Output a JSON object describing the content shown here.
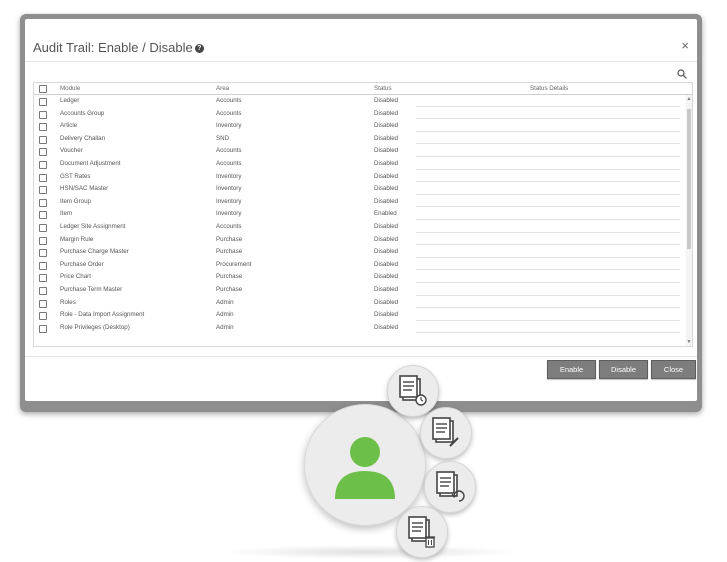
{
  "dialog": {
    "title": "Audit Trail: Enable / Disable",
    "help_icon": "question-circle-icon",
    "close_glyph": "×"
  },
  "grid": {
    "headers": {
      "module": "Module",
      "area": "Area",
      "status": "Status",
      "details": "Status Details"
    },
    "rows": [
      {
        "module": "Ledger",
        "area": "Accounts",
        "status": "Disabled"
      },
      {
        "module": "Accounts Group",
        "area": "Accounts",
        "status": "Disabled"
      },
      {
        "module": "Article",
        "area": "Inventory",
        "status": "Disabled"
      },
      {
        "module": "Delivery Challan",
        "area": "SND",
        "status": "Disabled"
      },
      {
        "module": "Voucher",
        "area": "Accounts",
        "status": "Disabled"
      },
      {
        "module": "Document Adjustment",
        "area": "Accounts",
        "status": "Disabled"
      },
      {
        "module": "GST Rates",
        "area": "Inventory",
        "status": "Disabled"
      },
      {
        "module": "HSN/SAC Master",
        "area": "Inventory",
        "status": "Disabled"
      },
      {
        "module": "Item Group",
        "area": "Inventory",
        "status": "Disabled"
      },
      {
        "module": "Item",
        "area": "Inventory",
        "status": "Enabled"
      },
      {
        "module": "Ledger Site Assignment",
        "area": "Accounts",
        "status": "Disabled"
      },
      {
        "module": "Margin Rule",
        "area": "Purchase",
        "status": "Disabled"
      },
      {
        "module": "Purchase Charge Master",
        "area": "Purchase",
        "status": "Disabled"
      },
      {
        "module": "Purchase Order",
        "area": "Procurement",
        "status": "Disabled"
      },
      {
        "module": "Price Chart",
        "area": "Purchase",
        "status": "Disabled"
      },
      {
        "module": "Purchase Term Master",
        "area": "Purchase",
        "status": "Disabled"
      },
      {
        "module": "Roles",
        "area": "Admin",
        "status": "Disabled"
      },
      {
        "module": "Role - Data Import Assignment",
        "area": "Admin",
        "status": "Disabled"
      },
      {
        "module": "Role Privileges (Desktop)",
        "area": "Admin",
        "status": "Disabled"
      }
    ]
  },
  "buttons": {
    "enable": "Enable",
    "disable": "Disable",
    "close": "Close"
  },
  "badges": {
    "center": "user-icon",
    "items": [
      "document-clock-icon",
      "document-edit-icon",
      "document-refresh-icon",
      "document-delete-icon"
    ]
  },
  "colors": {
    "accent_green": "#6cc04a",
    "button_gray": "#7d7d7d",
    "frame_gray": "#8e8e8e"
  }
}
